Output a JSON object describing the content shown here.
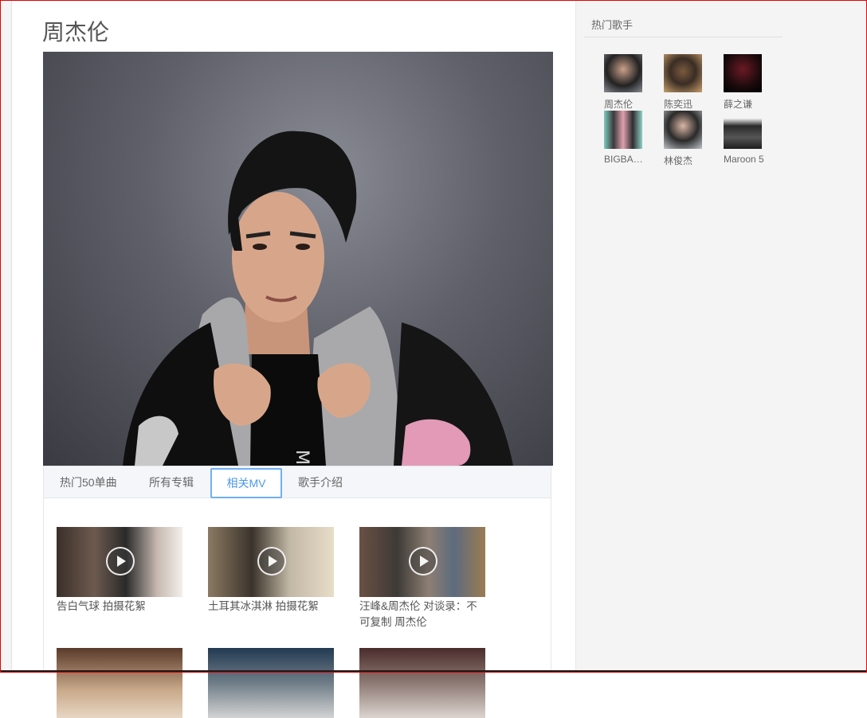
{
  "artist": {
    "name": "周杰伦"
  },
  "tabs": [
    {
      "label": "热门50单曲",
      "active": false
    },
    {
      "label": "所有专辑",
      "active": false
    },
    {
      "label": "相关MV",
      "active": true
    },
    {
      "label": "歌手介绍",
      "active": false
    }
  ],
  "mvs": [
    {
      "title": "告白气球 拍摄花絮",
      "icon": "play-icon"
    },
    {
      "title": "土耳其冰淇淋 拍摄花絮",
      "icon": "play-icon"
    },
    {
      "title": "汪峰&周杰伦 对谈录：不可复制 周杰伦",
      "icon": "play-icon"
    },
    {
      "title": "",
      "icon": "play-icon"
    },
    {
      "title": "",
      "icon": "play-icon"
    },
    {
      "title": "",
      "icon": "play-icon"
    }
  ],
  "sidebar": {
    "heading": "热门歌手",
    "singers": [
      {
        "name": "周杰伦"
      },
      {
        "name": "陈奕迅"
      },
      {
        "name": "薛之谦"
      },
      {
        "name": "BIGBANG"
      },
      {
        "name": "林俊杰"
      },
      {
        "name": "Maroon 5"
      }
    ]
  },
  "colors": {
    "accent": "#4a9ae8",
    "frame": "#e60000",
    "panel_bg": "#f4f4f4"
  }
}
